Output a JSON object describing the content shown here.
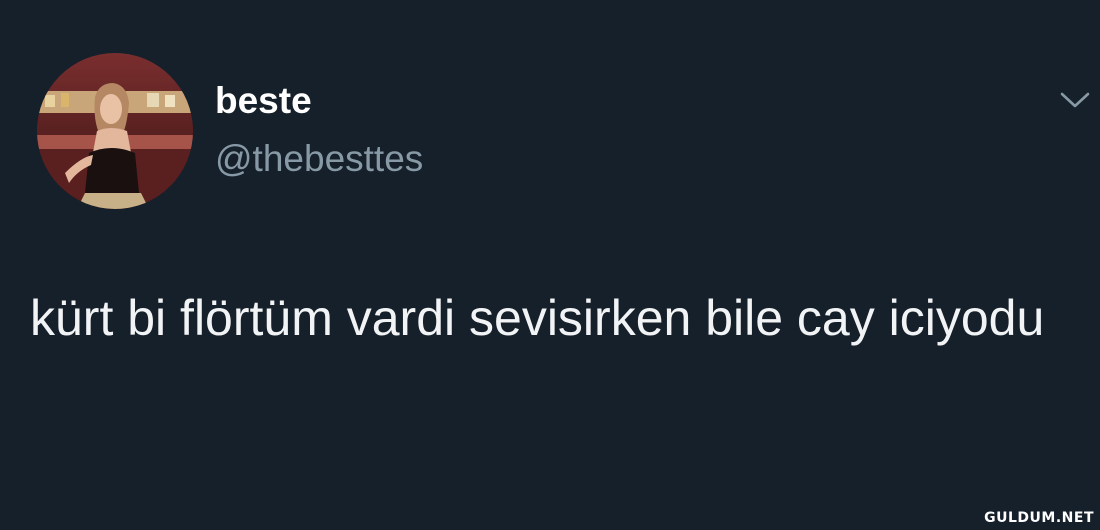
{
  "tweet": {
    "display_name": "beste",
    "handle": "@thebesttes",
    "text": "kürt bi flörtüm vardi sevisirken bile cay iciyodu",
    "menu_icon": "chevron-down-icon",
    "avatar_icon": "profile-photo"
  },
  "watermark": "GULDUM.NET",
  "colors": {
    "background": "#15202b",
    "name": "#ffffff",
    "handle": "#8899a6",
    "text": "#f1f3f5"
  }
}
